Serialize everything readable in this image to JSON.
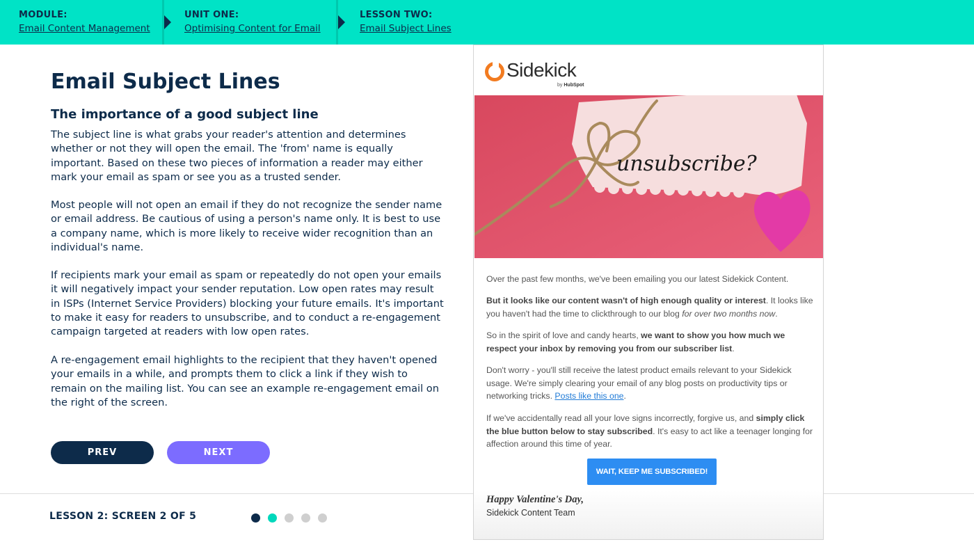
{
  "breadcrumb": {
    "module": {
      "label": "MODULE:",
      "link": "Email Content Management"
    },
    "unit": {
      "label": "UNIT ONE:",
      "link": "Optimising Content for Email"
    },
    "lesson": {
      "label": "LESSON TWO:",
      "link": "Email Subject Lines"
    }
  },
  "content": {
    "title": "Email Subject Lines",
    "subtitle": "The importance of a good subject line",
    "paragraphs": [
      "The subject line is what grabs your reader's attention and determines whether or not they will open the email. The 'from' name is equally important. Based on these two pieces of information a reader may either mark your email as spam or see you as a trusted sender.",
      "Most people will not open an email if they do not recognize the sender name or email address. Be cautious of using a person's name only. It is best to use a company name, which is more likely to receive wider recognition than an individual's name.",
      "If recipients mark your email as spam or repeatedly do not open your emails it will negatively impact your sender reputation. Low open rates may result in ISPs (Internet Service Providers) blocking your future emails. It's important to make it easy for readers to unsubscribe, and to conduct a re-engagement campaign targeted at readers with low open rates.",
      "A re-engagement email highlights to the recipient that they haven't opened your emails in a while, and prompts them to click a link if they wish to remain on the mailing list. You can see an example re-engagement email on the right of the screen."
    ]
  },
  "navigation": {
    "prev_label": "PREV",
    "next_label": "NEXT",
    "screen_label": "LESSON 2: SCREEN 2 OF 5",
    "total_screens": 5,
    "current_screen": 2
  },
  "email": {
    "logo_text": "Sidekick",
    "logo_by": "by",
    "logo_brand": "HubSpot",
    "hero_text": "unsubscribe?",
    "p1": "Over the past few months, we've been emailing you our latest Sidekick Content.",
    "p2_bold": "But it looks like our content wasn't of high enough quality or interest",
    "p2_rest": ". It looks like you haven't had the time to clickthrough to our blog ",
    "p2_italic": "for over two months now",
    "p2_end": ".",
    "p3_start": "So in the spirit of love and candy hearts, ",
    "p3_bold": "we want to show you how much we respect your inbox by removing you from our subscriber list",
    "p3_end": ".",
    "p4_start": "Don't worry - you'll still receive the latest product emails relevant to your Sidekick usage. We're simply clearing your email of any blog posts on productivity tips or networking tricks. ",
    "p4_link": "Posts like this one",
    "p4_end": ".",
    "p5_start": "If we've accidentally read all your love signs incorrectly, forgive us, and ",
    "p5_bold": "simply click the blue button below to stay subscribed",
    "p5_end": ". It's easy to act like a teenager longing for affection around this time of year.",
    "button_label": "WAIT, KEEP ME SUBSCRIBED!",
    "sign_off": "Happy Valentine's Day,",
    "team": "Sidekick Content Team"
  },
  "colors": {
    "topbar": "#00e3c6",
    "navy": "#0d2b4a",
    "next_button": "#7c6cff",
    "dot_current": "#00d8bc",
    "email_button": "#2d8df2",
    "logo_orange": "#f27b20"
  },
  "icons": {
    "breadcrumb_arrow": "triangle-right-icon",
    "logo": "sidekick-logo-icon",
    "heart": "heart-icon"
  }
}
